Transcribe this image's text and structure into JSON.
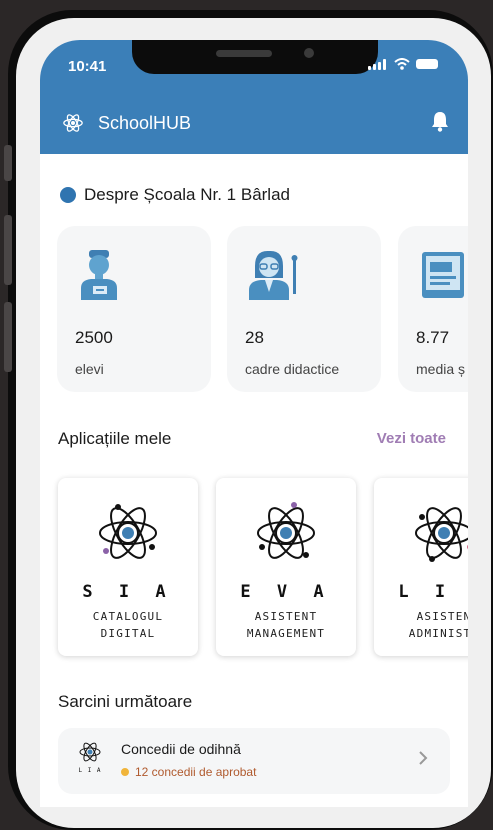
{
  "status": {
    "time": "10:41"
  },
  "header": {
    "app_title": "SchoolHUB"
  },
  "about": {
    "title": "Despre Școala Nr. 1 Bârlad",
    "stats": [
      {
        "value": "2500",
        "label": "elevi",
        "icon": "student-icon"
      },
      {
        "value": "28",
        "label": "cadre didactice",
        "icon": "teacher-icon"
      },
      {
        "value": "8.77",
        "label": "media ș",
        "icon": "book-icon"
      }
    ]
  },
  "apps": {
    "title": "Aplicațiile mele",
    "see_all": "Vezi toate",
    "items": [
      {
        "name": "S I A",
        "line1": "CATALOGUL",
        "line2": "DIGITAL"
      },
      {
        "name": "E V A",
        "line1": "ASISTENT",
        "line2": "MANAGEMENT"
      },
      {
        "name": "L I A",
        "line1": "ASISTEN",
        "line2": "ADMINISTR"
      }
    ]
  },
  "tasks": {
    "title": "Sarcini următoare",
    "items": [
      {
        "title": "Concedii de odihnă",
        "subtitle": "12 concedii de aprobat",
        "app_tag": "L I A"
      }
    ]
  },
  "colors": {
    "primary": "#3b7fb8",
    "accent": "#a07db4",
    "warning": "#f0b43a"
  }
}
